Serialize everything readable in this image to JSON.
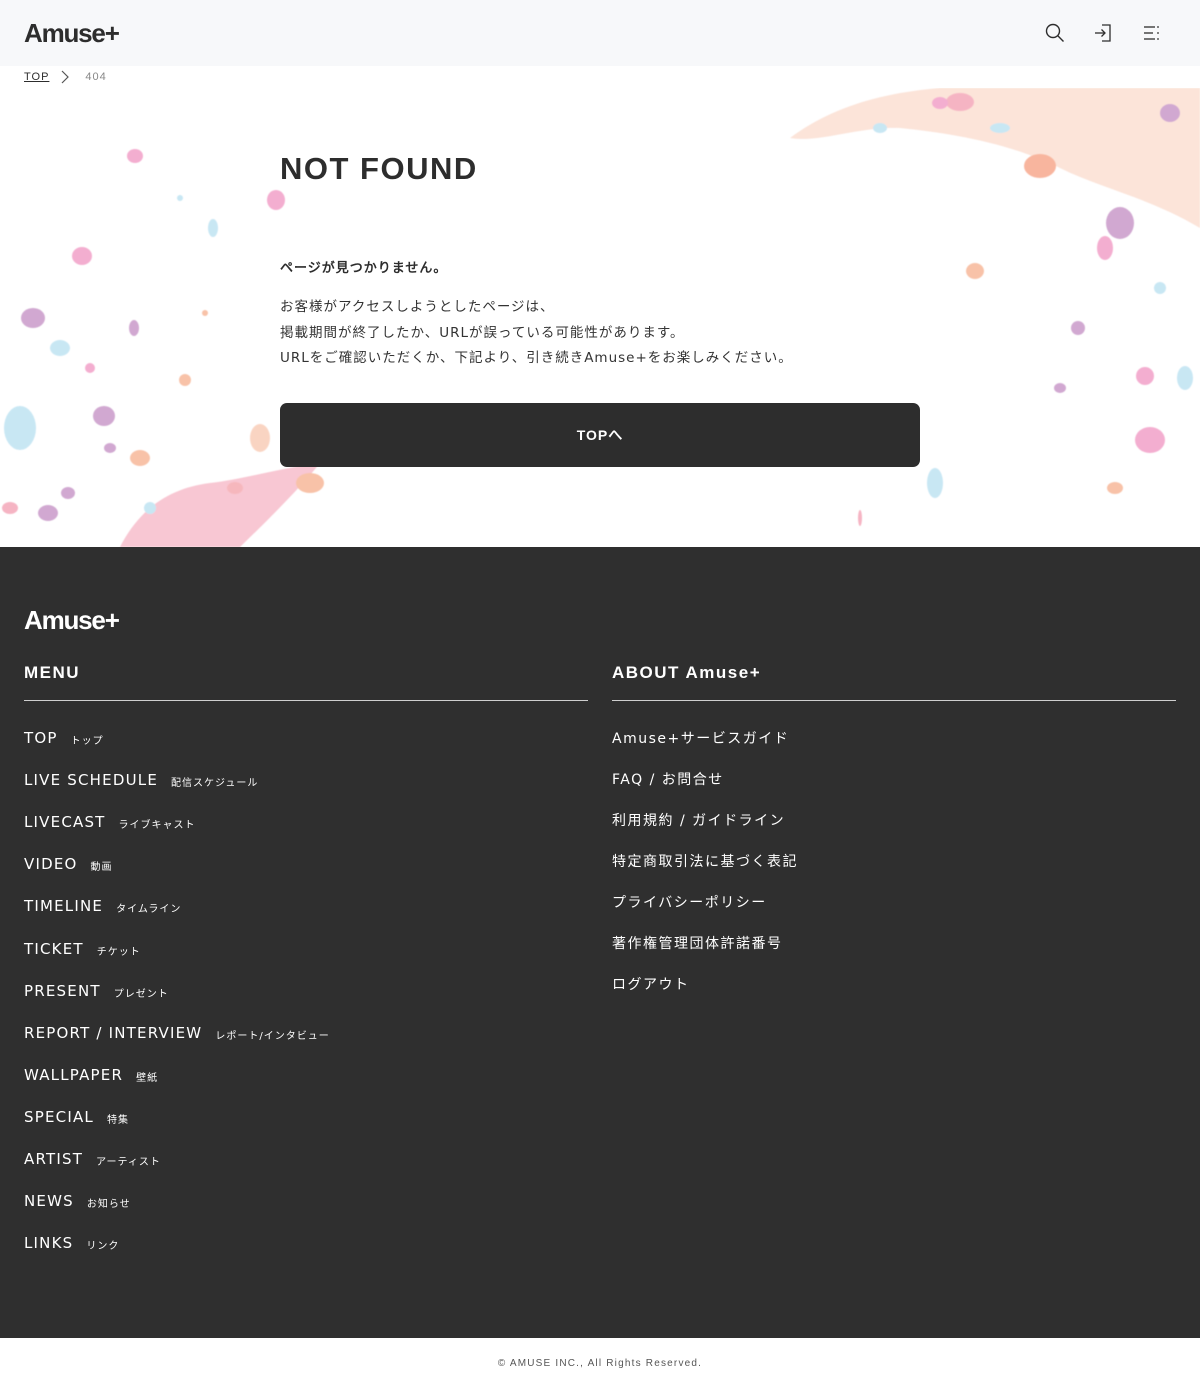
{
  "header": {
    "logo": "Amuse+",
    "icons": [
      "search-icon",
      "login-icon",
      "menu-icon"
    ]
  },
  "breadcrumb": {
    "home": "TOP",
    "current": "404"
  },
  "main": {
    "title": "NOT FOUND",
    "lead": "ページが見つかりません。",
    "body": [
      "お客様がアクセスしようとしたページは、",
      "掲載期間が終了したか、URLが誤っている可能性があります。",
      "URLをご確認いただくか、下記より、引き続きAmuse+をお楽しみください。"
    ],
    "button": "TOPへ"
  },
  "footer": {
    "logo": "Amuse+",
    "menu_heading": "MENU",
    "about_heading": "ABOUT Amuse+",
    "menu": [
      {
        "en": "TOP",
        "jp": "トップ"
      },
      {
        "en": "LIVE SCHEDULE",
        "jp": "配信スケジュール"
      },
      {
        "en": "LIVECAST",
        "jp": "ライブキャスト"
      },
      {
        "en": "VIDEO",
        "jp": "動画"
      },
      {
        "en": "TIMELINE",
        "jp": "タイムライン"
      },
      {
        "en": "TICKET",
        "jp": "チケット"
      },
      {
        "en": "PRESENT",
        "jp": "プレゼント"
      },
      {
        "en": "REPORT / INTERVIEW",
        "jp": "レポート/インタビュー"
      },
      {
        "en": "WALLPAPER",
        "jp": "壁紙"
      },
      {
        "en": "SPECIAL",
        "jp": "特集"
      },
      {
        "en": "ARTIST",
        "jp": "アーティスト"
      },
      {
        "en": "NEWS",
        "jp": "お知らせ"
      },
      {
        "en": "LINKS",
        "jp": "リンク"
      }
    ],
    "about": [
      "Amuse+サービスガイド",
      "FAQ / お問合せ",
      "利用規約 / ガイドライン",
      "特定商取引法に基づく表記",
      "プライバシーポリシー",
      "著作権管理団体許諾番号",
      "ログアウト"
    ],
    "copyright": "© AMUSE INC., All Rights Reserved."
  },
  "colors": {
    "footer_bg": "#2f2f2f",
    "button_bg": "#2d2d2d",
    "header_bg": "#f7f8fa",
    "splash": [
      "#f4a7b9",
      "#f7b89a",
      "#bfe3f2",
      "#c99ac9",
      "#f2a0c8"
    ]
  }
}
